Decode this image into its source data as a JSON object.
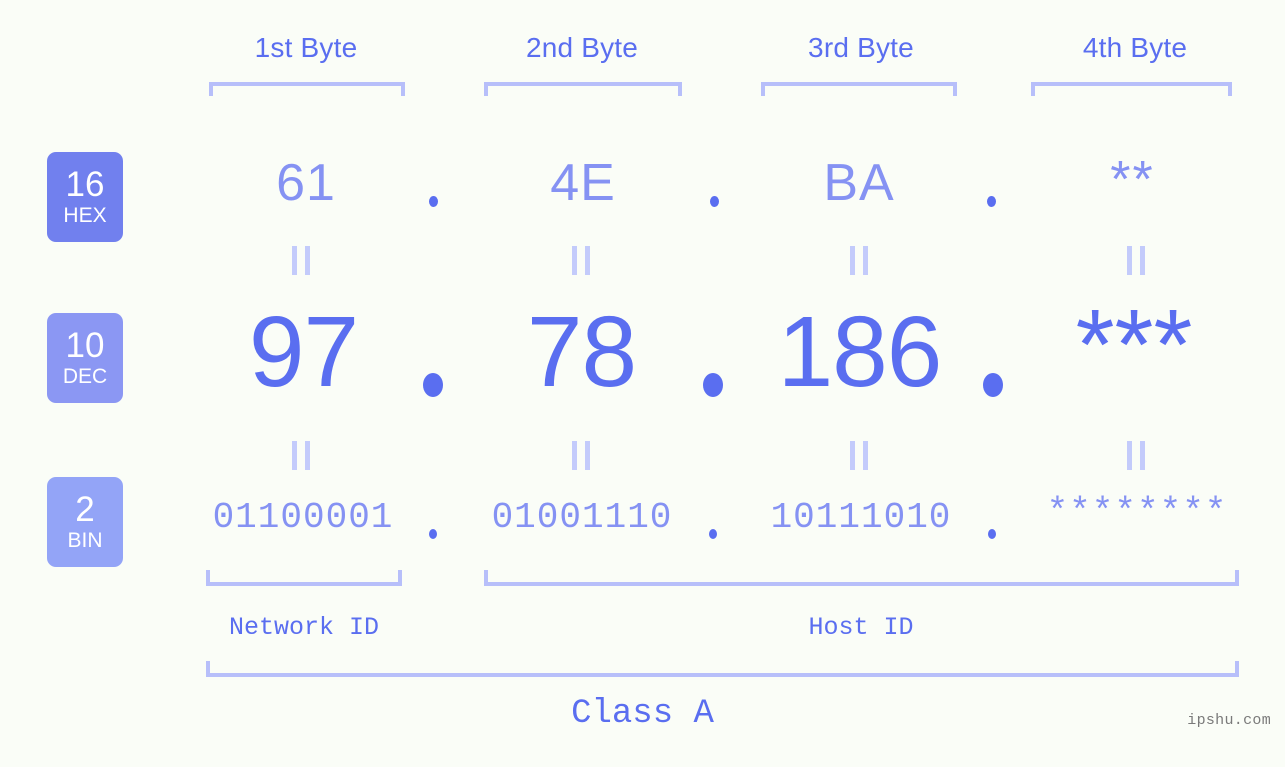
{
  "meta": {
    "background_color": "#fafdf7",
    "accent_color": "#5a6ef0",
    "accent_light_color": "#8592f3",
    "bracket_color": "#b7bffa"
  },
  "byte_headers": [
    {
      "label": "1st Byte"
    },
    {
      "label": "2nd Byte"
    },
    {
      "label": "3rd Byte"
    },
    {
      "label": "4th Byte"
    }
  ],
  "rows": [
    {
      "badge_number": "16",
      "badge_radix": "HEX",
      "badge_color": "#7180ee",
      "values": [
        "61",
        "4E",
        "BA",
        "**"
      ],
      "separator": "."
    },
    {
      "badge_number": "10",
      "badge_radix": "DEC",
      "badge_color": "#8b97f3",
      "values": [
        "97",
        "78",
        "186",
        "***"
      ],
      "separator": "."
    },
    {
      "badge_number": "2",
      "badge_radix": "BIN",
      "badge_color": "#93a4f7",
      "values": [
        "01100001",
        "01001110",
        "10111010",
        "********"
      ],
      "separator": "."
    }
  ],
  "equals_symbol": "||",
  "id_sections": [
    {
      "label": "Network ID"
    },
    {
      "label": "Host ID"
    }
  ],
  "class_label": "Class A",
  "watermark": "ipshu.com"
}
